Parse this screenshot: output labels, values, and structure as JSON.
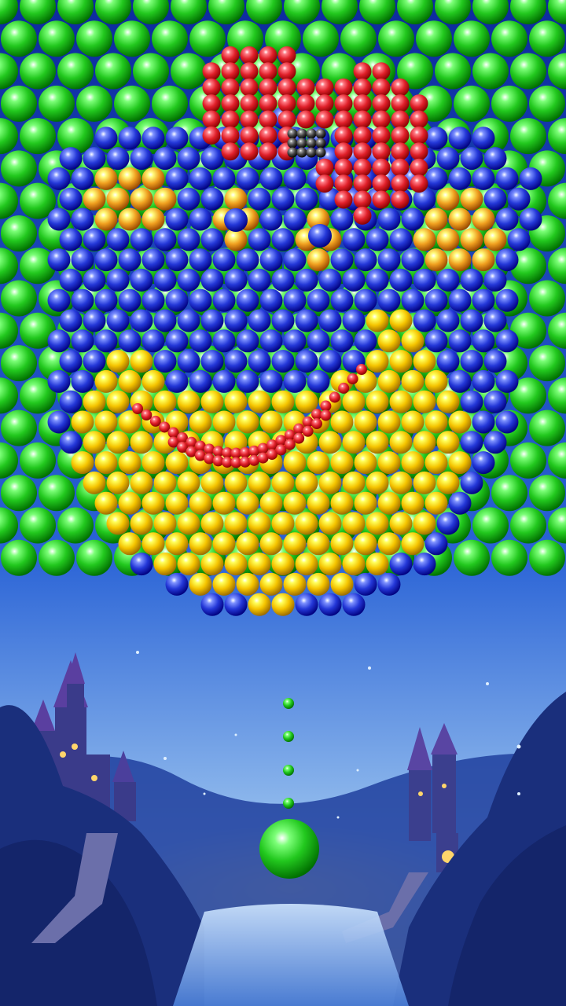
{
  "game": {
    "genre": "bubble-shooter",
    "board_picture": "bear-face-with-bow",
    "background_scene": "night-castle-valley"
  },
  "colors": {
    "green": "#22c81e",
    "blue": "#2438d8",
    "yellow": "#f5c400",
    "orange": "#f0a020",
    "red": "#e0202a",
    "gray": "#444444",
    "sky_top": "#1233a8",
    "sky_bottom": "#e8d070"
  },
  "board": {
    "background_bubble_color": "green",
    "regions": [
      {
        "name": "left-ear",
        "color": "blue"
      },
      {
        "name": "right-ear",
        "color": "blue"
      },
      {
        "name": "head",
        "color": "blue"
      },
      {
        "name": "left-ear-inner",
        "color": "orange"
      },
      {
        "name": "right-ear-inner",
        "color": "orange"
      },
      {
        "name": "face",
        "color": "yellow"
      },
      {
        "name": "nose",
        "color": "blue"
      },
      {
        "name": "smile",
        "color": "red"
      },
      {
        "name": "left-eye",
        "color": "orange"
      },
      {
        "name": "right-eye",
        "color": "orange"
      },
      {
        "name": "bow",
        "color": "red"
      },
      {
        "name": "bow-knot",
        "color": "gray"
      }
    ]
  },
  "shooter": {
    "current_bubble_color": "green",
    "aim_guide_dots": 4
  }
}
